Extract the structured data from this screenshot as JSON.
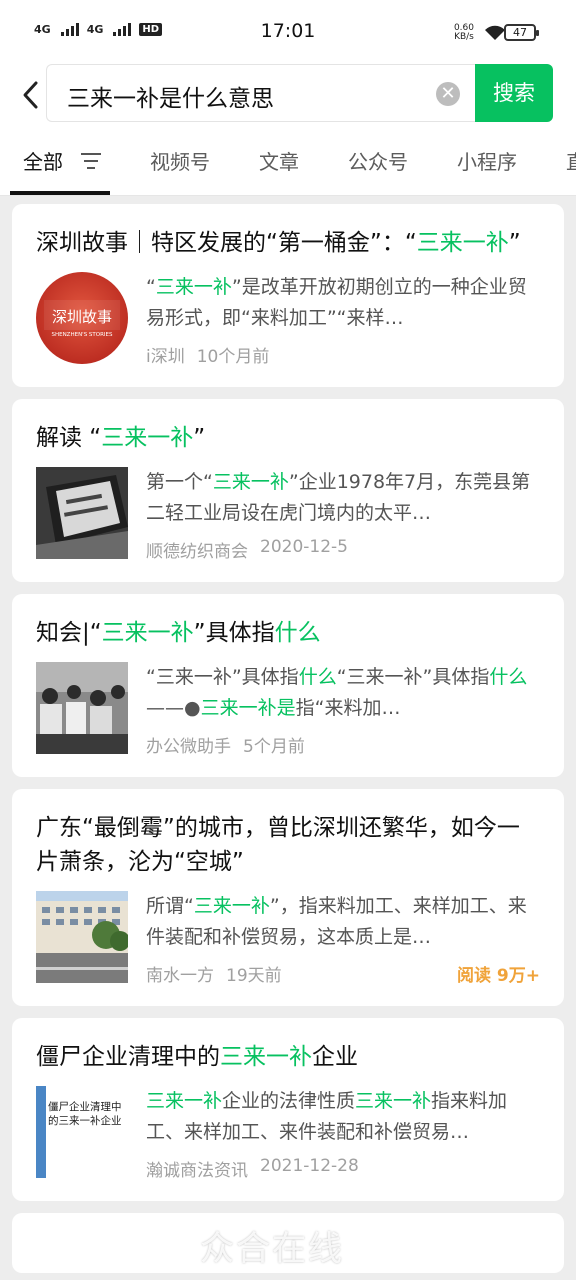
{
  "status": {
    "net1": "4G",
    "net2": "4G",
    "hd": "HD",
    "time": "17:01",
    "speed_value": "0.60",
    "speed_unit": "KB/s",
    "battery": "47"
  },
  "search": {
    "query": "三来一补是什么意思",
    "button": "搜索"
  },
  "tabs": [
    "全部",
    "视频号",
    "文章",
    "公众号",
    "小程序",
    "直"
  ],
  "results": [
    {
      "title": [
        {
          "t": "深圳故事｜特区发展的“第一桶金”：“",
          "h": false
        },
        {
          "t": "三来一补",
          "h": true
        },
        {
          "t": "”",
          "h": false
        }
      ],
      "snippet": [
        {
          "t": "“",
          "h": false
        },
        {
          "t": "三来一补",
          "h": true
        },
        {
          "t": "”是改革开放初期创立的一种企业贸易形式，即“来料加工”“来样…",
          "h": false
        }
      ],
      "thumb_text": "深圳故事",
      "thumb_sub": "SHENZHEN'S STORIES",
      "source": "i深圳",
      "time": "10个月前",
      "reads": ""
    },
    {
      "title": [
        {
          "t": "解读 “",
          "h": false
        },
        {
          "t": "三来一补",
          "h": true
        },
        {
          "t": "”",
          "h": false
        }
      ],
      "snippet": [
        {
          "t": "第一个“",
          "h": false
        },
        {
          "t": "三来一补",
          "h": true
        },
        {
          "t": "”企业1978年7月，东莞县第二轻工业局设在虎门境内的太平…",
          "h": false
        }
      ],
      "source": "顺德纺织商会",
      "time": "2020-12-5",
      "reads": ""
    },
    {
      "title": [
        {
          "t": "知会|“",
          "h": false
        },
        {
          "t": "三来一补",
          "h": true
        },
        {
          "t": "”具体指",
          "h": false
        },
        {
          "t": "什么",
          "h": true
        }
      ],
      "snippet": [
        {
          "t": "“三来一补”具体指",
          "h": false
        },
        {
          "t": "什么",
          "h": true
        },
        {
          "t": "“三来一补”具体指",
          "h": false
        },
        {
          "t": "什么",
          "h": true
        },
        {
          "t": "——●",
          "h": false
        },
        {
          "t": "三来一补是",
          "h": true
        },
        {
          "t": "指“来料加…",
          "h": false
        }
      ],
      "source": "办公微助手",
      "time": "5个月前",
      "reads": ""
    },
    {
      "title": [
        {
          "t": "广东“最倒霉”的城市，曾比深圳还繁华，如今一片萧条，沦为“空城”",
          "h": false
        }
      ],
      "snippet": [
        {
          "t": "所谓“",
          "h": false
        },
        {
          "t": "三来一补",
          "h": true
        },
        {
          "t": "”，指来料加工、来样加工、来件装配和补偿贸易，这本质上是…",
          "h": false
        }
      ],
      "source": "南水一方",
      "time": "19天前",
      "reads": "阅读 9万+"
    },
    {
      "title": [
        {
          "t": "僵尸企业清理中的",
          "h": false
        },
        {
          "t": "三来一补",
          "h": true
        },
        {
          "t": "企业",
          "h": false
        }
      ],
      "snippet": [
        {
          "t": "三来一补",
          "h": true
        },
        {
          "t": "企业的法律性质",
          "h": false
        },
        {
          "t": "三来一补",
          "h": true
        },
        {
          "t": "指来料加工、来样加工、来件装配和补偿贸易…",
          "h": false
        }
      ],
      "thumb_text": "僵尸企业清理中的三来一补企业",
      "source": "瀚诚商法资讯",
      "time": "2021-12-28",
      "reads": ""
    }
  ],
  "watermark": "众合在线"
}
